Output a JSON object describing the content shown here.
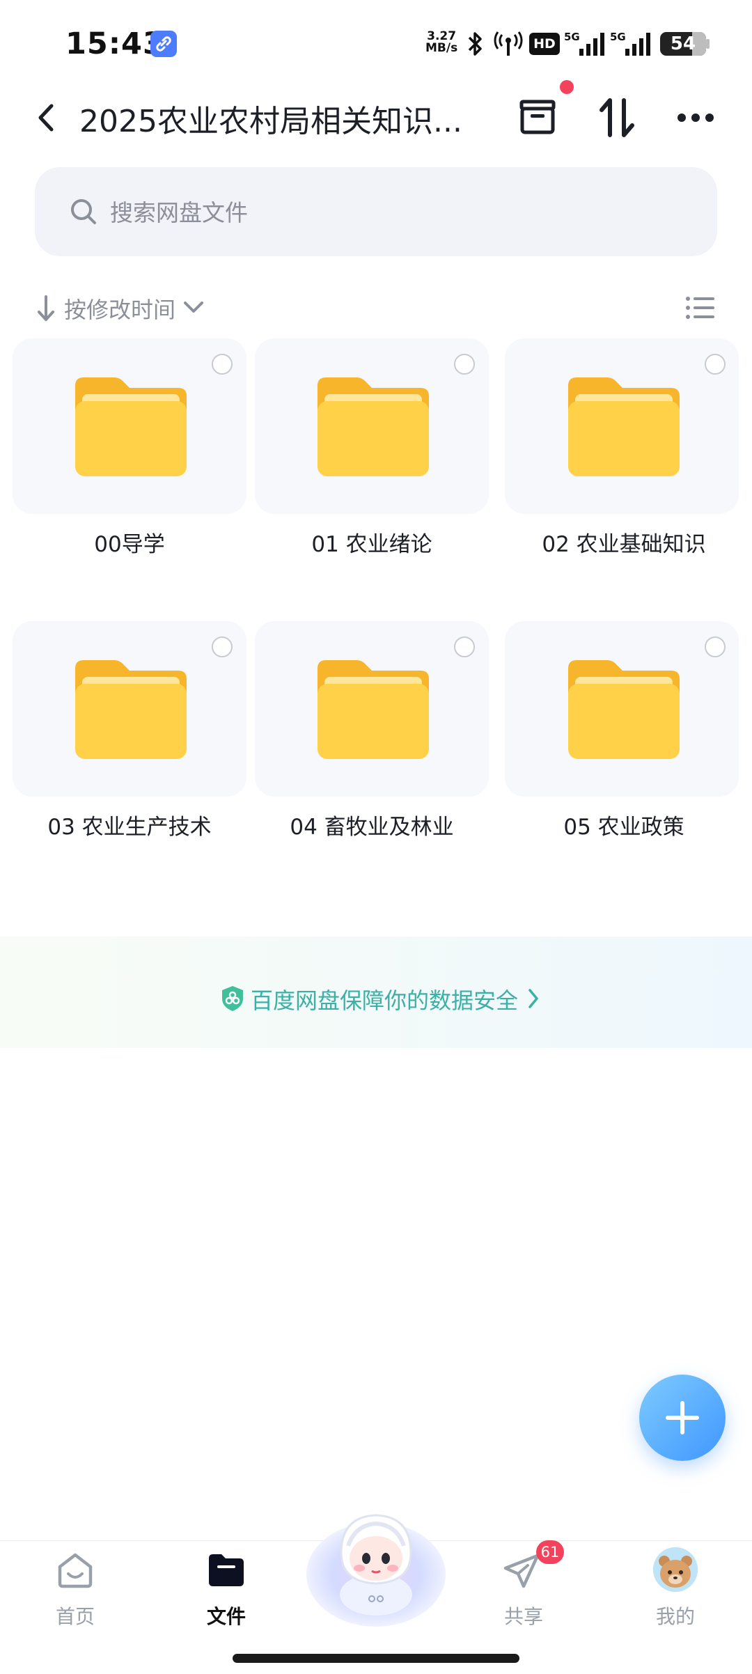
{
  "status_bar": {
    "time": "15:43",
    "net_speed_value": "3.27",
    "net_speed_unit": "MB/s",
    "hd_label": "HD",
    "network_1": "5G",
    "network_2": "5G",
    "battery": "54"
  },
  "header": {
    "title": "2025农业农村局相关知识..."
  },
  "search": {
    "placeholder": "搜索网盘文件"
  },
  "sort": {
    "label": "按修改时间"
  },
  "folders": [
    {
      "name": "00导学"
    },
    {
      "name": "01 农业绪论"
    },
    {
      "name": "02 农业基础知识"
    },
    {
      "name": "03 农业生产技术"
    },
    {
      "name": "04 畜牧业及林业"
    },
    {
      "name": "05 农业政策"
    }
  ],
  "banner": {
    "text": "百度网盘保障你的数据安全"
  },
  "bottom_nav": {
    "items": [
      {
        "label": "首页",
        "icon": "home-icon"
      },
      {
        "label": "文件",
        "icon": "folder-icon",
        "active": true
      },
      {
        "label": "",
        "icon": "mascot-icon"
      },
      {
        "label": "共享",
        "icon": "paper-plane-icon"
      },
      {
        "label": "我的",
        "icon": "avatar"
      }
    ],
    "share_badge": "61"
  },
  "colors": {
    "accent": "#3f97ff",
    "folder": "#ffcf48",
    "badge": "#f2425c",
    "banner_text": "#3bb0a6"
  }
}
